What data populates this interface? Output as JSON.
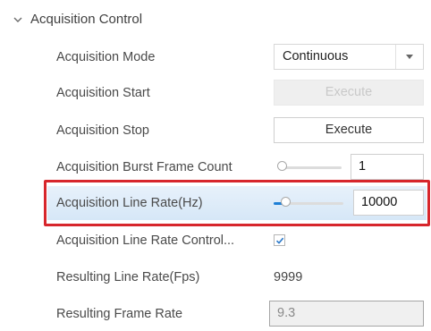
{
  "section": {
    "title": "Acquisition Control"
  },
  "rows": {
    "mode": {
      "label": "Acquisition Mode",
      "value": "Continuous"
    },
    "start": {
      "label": "Acquisition Start",
      "button": "Execute"
    },
    "stop": {
      "label": "Acquisition Stop",
      "button": "Execute"
    },
    "burst": {
      "label": "Acquisition Burst Frame Count",
      "value": "1",
      "slider_fraction": 0.0
    },
    "line_rate": {
      "label": "Acquisition Line Rate(Hz)",
      "value": "10000",
      "slider_fraction": 0.1
    },
    "rate_control": {
      "label": "Acquisition Line Rate Control...",
      "checked": true
    },
    "resulting_line_rate": {
      "label": "Resulting Line Rate(Fps)",
      "value": "9999"
    },
    "resulting_frame_rate": {
      "label": "Resulting Frame Rate",
      "value": "9.3"
    }
  },
  "colors": {
    "accent": "#1e7fd6",
    "highlight_border": "#d7262c",
    "selected_row": "#dcebf8"
  }
}
